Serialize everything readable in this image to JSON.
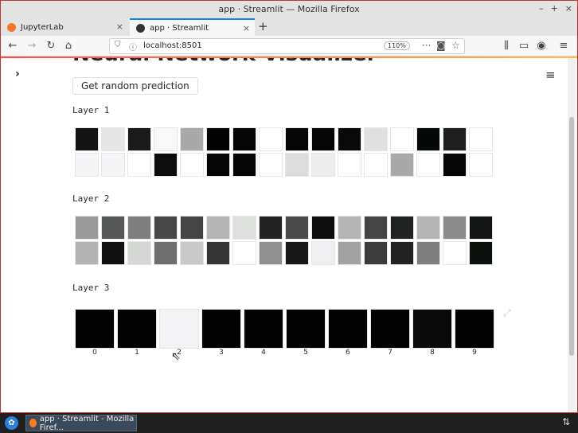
{
  "window": {
    "title": "app · Streamlit — Mozilla Firefox"
  },
  "tabs": [
    {
      "label": "JupyterLab",
      "favicon_color": "#f37726"
    },
    {
      "label": "app · Streamlit",
      "favicon_color": "#333333"
    }
  ],
  "navbar": {
    "url": "localhost:8501",
    "zoom": "110%"
  },
  "page": {
    "heading": "Neural Network Visualizer",
    "button_label": "Get random prediction",
    "layers": [
      {
        "label": "Layer 1",
        "cells": [
          "#141414",
          "#e6e6e6",
          "#1a1a1a",
          "#f8f8f8",
          "#a9a9a9",
          "#030303",
          "#050505",
          "#ffffff",
          "#050505",
          "#050505",
          "#0a0a0a",
          "#e0e0e0",
          "#ffffff",
          "#050a08",
          "#1e1e1e",
          "#ffffff",
          "#f5f5f7",
          "#f5f5f7",
          "#ffffff",
          "#0c0c0c",
          "#ffffff",
          "#050505",
          "#050505",
          "#ffffff",
          "#dcdcdc",
          "#ededed",
          "#ffffff",
          "#ffffff",
          "#a9a9a9",
          "#ffffff",
          "#050505",
          "#ffffff"
        ]
      },
      {
        "label": "Layer 2",
        "cells": [
          "#9a9a9a",
          "#555756",
          "#7e7e7e",
          "#474847",
          "#434443",
          "#b5b5b5",
          "#dcdfdc",
          "#222222",
          "#494a49",
          "#0c0c0c",
          "#b5b5b5",
          "#444544",
          "#1f2221",
          "#b5b5b5",
          "#8a8a8a",
          "#131614",
          "#b2b2b2",
          "#101010",
          "#d5d7d5",
          "#6e6e6e",
          "#c9c9c9",
          "#343434",
          "#ffffff",
          "#8f8f8f",
          "#181818",
          "#efeff1",
          "#a2a2a2",
          "#3c3c3c",
          "#222222",
          "#7e7e7e",
          "#ffffff",
          "#0c110e"
        ]
      },
      {
        "label": "Layer 3",
        "cells": [
          "#020202",
          "#020202",
          "#f3f3f6",
          "#020202",
          "#020202",
          "#020202",
          "#020202",
          "#020202",
          "#0a0a0a",
          "#020202"
        ],
        "labels": [
          "0",
          "1",
          "2",
          "3",
          "4",
          "5",
          "6",
          "7",
          "8",
          "9"
        ]
      }
    ]
  },
  "taskbar": {
    "task_label": "app · Streamlit - Mozilla Firef..."
  }
}
